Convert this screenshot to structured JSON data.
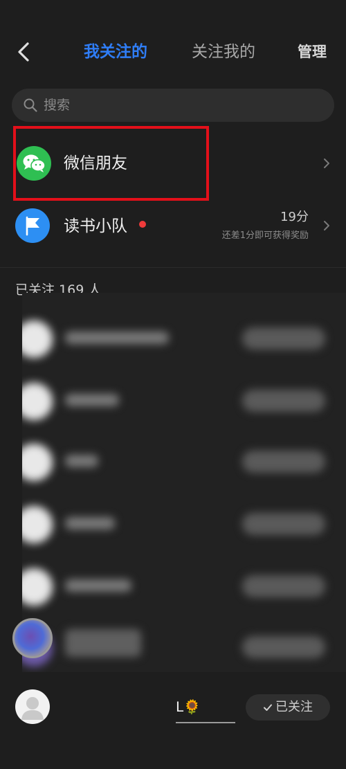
{
  "header": {
    "tabs": [
      {
        "label": "我关注的",
        "active": true
      },
      {
        "label": "关注我的",
        "active": false
      }
    ],
    "manage_label": "管理",
    "back_icon": "back-arrow-icon"
  },
  "search": {
    "placeholder": "搜索",
    "icon": "search-icon"
  },
  "entries": [
    {
      "title": "微信朋友",
      "icon": "wechat-icon",
      "highlighted": true
    },
    {
      "title": "读书小队",
      "icon": "flag-icon",
      "score": "19分",
      "hint": "还差1分即可获得奖励",
      "unread_dot": true
    }
  ],
  "following": {
    "count_label": "已关注 169 人"
  },
  "last_row": {
    "name_fragment": "ᒪ🌻",
    "button_label": "已关注"
  },
  "colors": {
    "accent": "#2f7df6",
    "background": "#1e1e1e",
    "highlight": "#e3101a",
    "wechat": "#2fbf52",
    "team": "#2d8ff3"
  }
}
